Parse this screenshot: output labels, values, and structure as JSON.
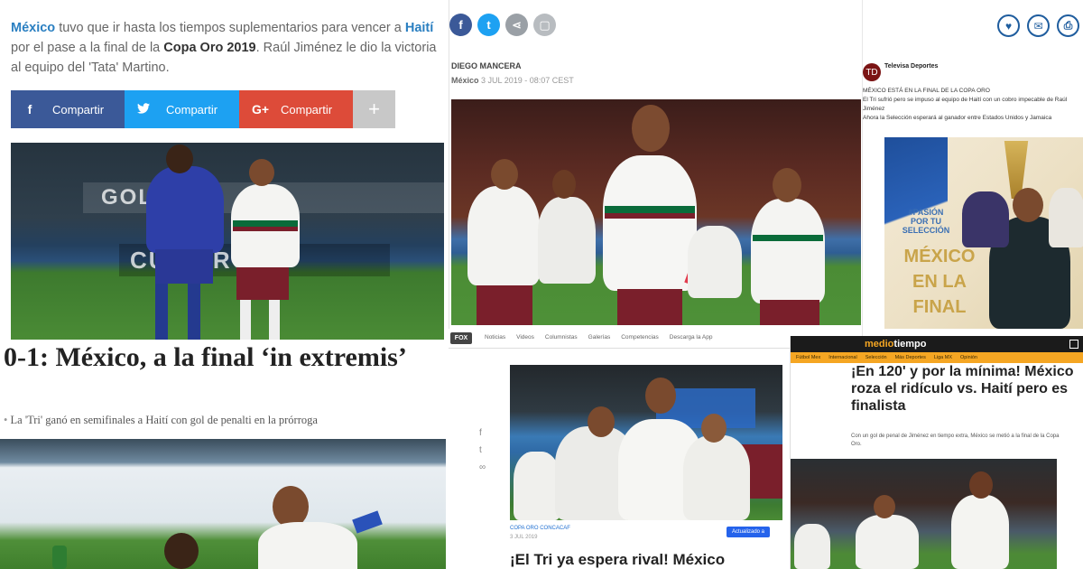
{
  "left_article": {
    "lead": {
      "link1": "México",
      "text1": " tuvo que ir hasta los tiempos suplementarios para vencer a ",
      "link2": "Haití",
      "text2": " por el pase a la final de la ",
      "strong": "Copa Oro 2019",
      "text3": ". Raúl Jiménez le dio la victoria al equipo del 'Tata' Martino."
    },
    "share": {
      "facebook_label": "Compartir",
      "twitter_label": "Compartir",
      "google_label": "Compartir",
      "more_label": "+"
    },
    "photo1_board": "GOLDCUP",
    "photo1_board2": "CUP ORO",
    "headline": "0-1: México, a la final ‘in extremis’",
    "subtitle": "La 'Tri' ganó en semifinales a Haití con gol de penalti en la prórroga"
  },
  "center_article": {
    "author": "DIEGO MANCERA",
    "section": "México",
    "date": "3 JUL 2019 - 08:07 CEST"
  },
  "right_tweet": {
    "account": "Televisa Deportes",
    "line1": "MÉXICO ESTÁ EN LA FINAL DE LA COPA ORO",
    "line2": "El Tri sufrió pero se impuso al equipo de Haití con un cobro impecable de Raúl Jiménez",
    "line3": "Ahora la Selección esperará al ganador entre Estados Unidos y Jamaica",
    "poster_tag": "#PASIÓN POR TU SELECCIÓN",
    "poster_title": "MÉXICO EN LA FINAL"
  },
  "center_nav": {
    "logo": "FOX",
    "items": [
      "Noticias",
      "Videos",
      "Columnistas",
      "Galerías",
      "Competencias",
      "Descarga la App"
    ]
  },
  "card": {
    "category": "COPA ORO CONCACAF",
    "date": "3 JUL 2019",
    "pill": "Actualizado a",
    "headline": "¡El Tri ya espera rival! México"
  },
  "mediotiempo": {
    "logo_a": "medio",
    "logo_b": "tiempo",
    "menu": [
      "Fútbol Mex",
      "Internacional",
      "Selección",
      "Más Deportes",
      "Liga MX",
      "Opinión"
    ],
    "headline": "¡En 120' y por la mínima! México roza el ridículo vs. Haití pero es finalista",
    "body": "Con un gol de penal de Jiménez en tiempo extra, México se metió a la final de la Copa Oro."
  },
  "colors": {
    "facebook": "#3b5998",
    "twitter": "#1da1f2",
    "google": "#dd4b39",
    "mexico_green": "#0a6b3a",
    "mexico_maroon": "#7a1f2b",
    "haiti_blue": "#2e3fa8",
    "mediotiempo_orange": "#f5a623"
  }
}
